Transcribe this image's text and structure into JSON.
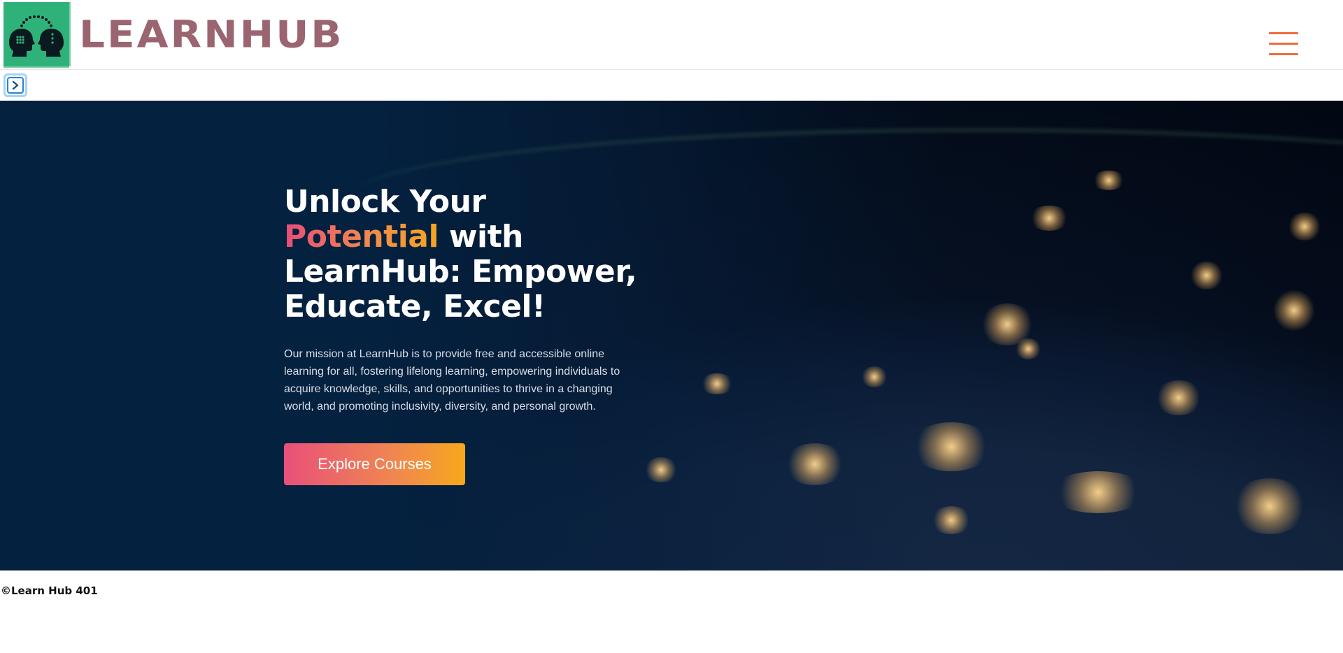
{
  "header": {
    "logo_text": "LEARNHUB",
    "logo_icon": "two-heads-brain-icon",
    "menu_icon": "hamburger-menu-icon"
  },
  "sidebar_toggle": {
    "icon": "chevron-right-icon"
  },
  "hero": {
    "title_line1": "Unlock Your",
    "title_highlight": "Potential",
    "title_rest": " with LearnHub: Empower, Educate, Excel!",
    "description": "Our mission at LearnHub is to provide free and accessible online learning for all, fostering lifelong learning, empowering individuals to acquire knowledge, skills, and opportunities to thrive in a changing world, and promoting inclusivity, diversity, and personal growth.",
    "cta_label": "Explore Courses"
  },
  "footer": {
    "text": "©Learn Hub 401"
  },
  "colors": {
    "logo_bg": "#2fb27a",
    "logo_text": "#9a6470",
    "menu": "#f06a3f",
    "hero_bg": "#04213f",
    "accent_gradient_start": "#e8507a",
    "accent_gradient_end": "#f6a81c",
    "toggle_border": "#1f86d9"
  }
}
